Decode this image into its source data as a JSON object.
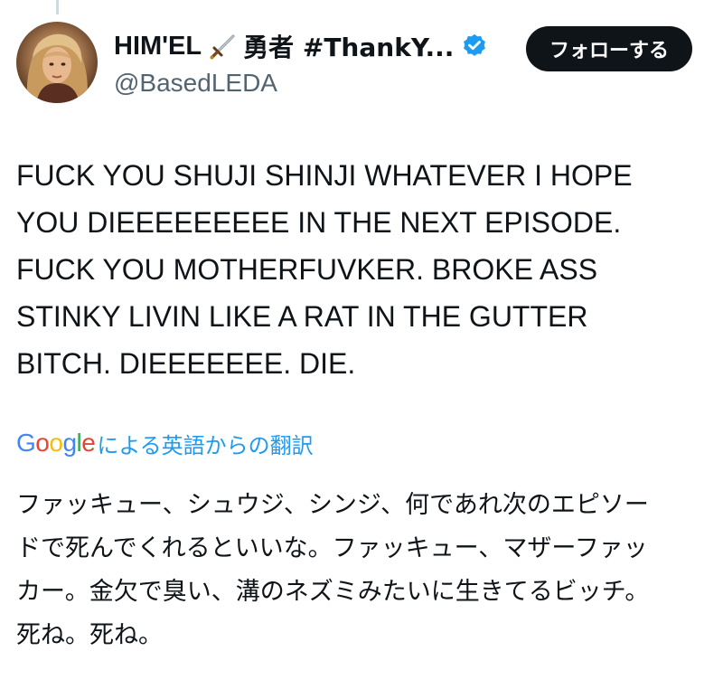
{
  "tweet": {
    "author": {
      "display_name": "HIM'EL",
      "display_name_suffix": "勇者 #ThankY...",
      "handle": "@BasedLEDA",
      "verified": true,
      "emoji_icon": "dagger-icon"
    },
    "follow_label": "フォローする",
    "text_lines": [
      "FUCK YOU SHUJI SHINJI WHATEVER I HOPE",
      "YOU DIEEEEEEEEE IN THE NEXT EPISODE.",
      "FUCK YOU MOTHERFUVKER. BROKE ASS",
      "STINKY LIVIN LIKE A RAT IN THE GUTTER",
      "BITCH. DIEEEEEEE. DIE."
    ],
    "translation": {
      "provider_letters": [
        "G",
        "o",
        "o",
        "g",
        "l",
        "e"
      ],
      "label": "による英語からの翻訳",
      "lines": [
        "ファッキュー、シュウジ、シンジ、何であれ次のエピソー",
        "ドで死んでくれるといいな。ファッキュー、マザーファッ",
        "カー。金欠で臭い、溝のネズミみたいに生きてるビッチ。",
        "死ね。死ね。"
      ]
    }
  },
  "colors": {
    "text_primary": "#0f1419",
    "text_secondary": "#536471",
    "accent": "#1d9bf0",
    "follow_bg": "#0f1419"
  }
}
